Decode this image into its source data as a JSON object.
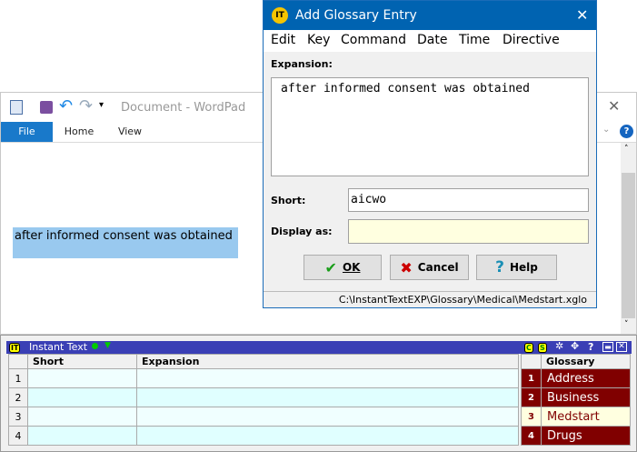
{
  "wordpad": {
    "title": "Document - WordPad",
    "tabs": [
      "File",
      "Home",
      "View"
    ],
    "selected_text": "after informed consent was obtained",
    "accent": "#1979ca"
  },
  "dialog": {
    "title": "Add Glossary Entry",
    "menu": [
      "Edit",
      "Key",
      "Command",
      "Date",
      "Time",
      "Directive"
    ],
    "expansion_label": "Expansion:",
    "expansion_value": "after informed consent was obtained",
    "short_label": "Short:",
    "short_value": "aicwo",
    "display_label": "Display as:",
    "display_value": "",
    "ok": "OK",
    "cancel": "Cancel",
    "help": "Help",
    "status": "C:\\InstantTextEXP\\Glossary\\Medical\\Medstart.xglo"
  },
  "instant_text": {
    "title": "Instant Text",
    "logo": "IT",
    "badge_c": "C",
    "badge_s": "S",
    "columns": [
      "Short",
      "Expansion"
    ],
    "rows": [
      "1",
      "2",
      "3",
      "4"
    ],
    "glossary_header": "Glossary",
    "glossary": [
      {
        "n": "1",
        "name": "Address"
      },
      {
        "n": "2",
        "name": "Business"
      },
      {
        "n": "3",
        "name": "Medstart",
        "current": true
      },
      {
        "n": "4",
        "name": "Drugs"
      }
    ]
  }
}
